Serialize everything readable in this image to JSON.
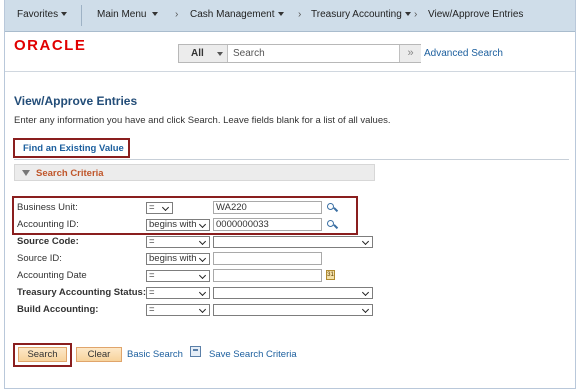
{
  "navbar": {
    "favorites": "Favorites",
    "main_menu": "Main Menu",
    "breadcrumb": [
      "Cash Management",
      "Treasury Accounting",
      "View/Approve Entries"
    ]
  },
  "header": {
    "logo": "ORACLE",
    "search_scope": "All",
    "search_placeholder": "Search",
    "go_icon": "double-chevron-right-icon",
    "advanced_search": "Advanced Search"
  },
  "page": {
    "title": "View/Approve Entries",
    "instructions": "Enter any information you have and click Search. Leave fields blank for a list of all values.",
    "tab_find": "Find an Existing Value",
    "criteria_title": "Search Criteria"
  },
  "fields": [
    {
      "label": "Business Unit:",
      "operator": "=",
      "value": "WA220"
    },
    {
      "label": "Accounting ID:",
      "operator": "begins with",
      "value": "0000000033"
    },
    {
      "label": "Source Code:",
      "operator": "=",
      "value": ""
    },
    {
      "label": "Source ID:",
      "operator": "begins with",
      "value": ""
    },
    {
      "label": "Accounting Date",
      "operator": "=",
      "value": ""
    },
    {
      "label": "Treasury Accounting Status:",
      "operator": "=",
      "value": ""
    },
    {
      "label": "Build Accounting:",
      "operator": "=",
      "value": ""
    }
  ],
  "actions": {
    "search": "Search",
    "clear": "Clear",
    "basic_search": "Basic Search",
    "save_search": "Save Search Criteria"
  },
  "colors": {
    "navbar_bg": "#cfdde9",
    "logo": "#e10000",
    "title": "#234d78",
    "link": "#1c5f9e",
    "criteria_label": "#c0562a",
    "highlight_box": "#8a1e1e",
    "button": "#f7d39c"
  }
}
